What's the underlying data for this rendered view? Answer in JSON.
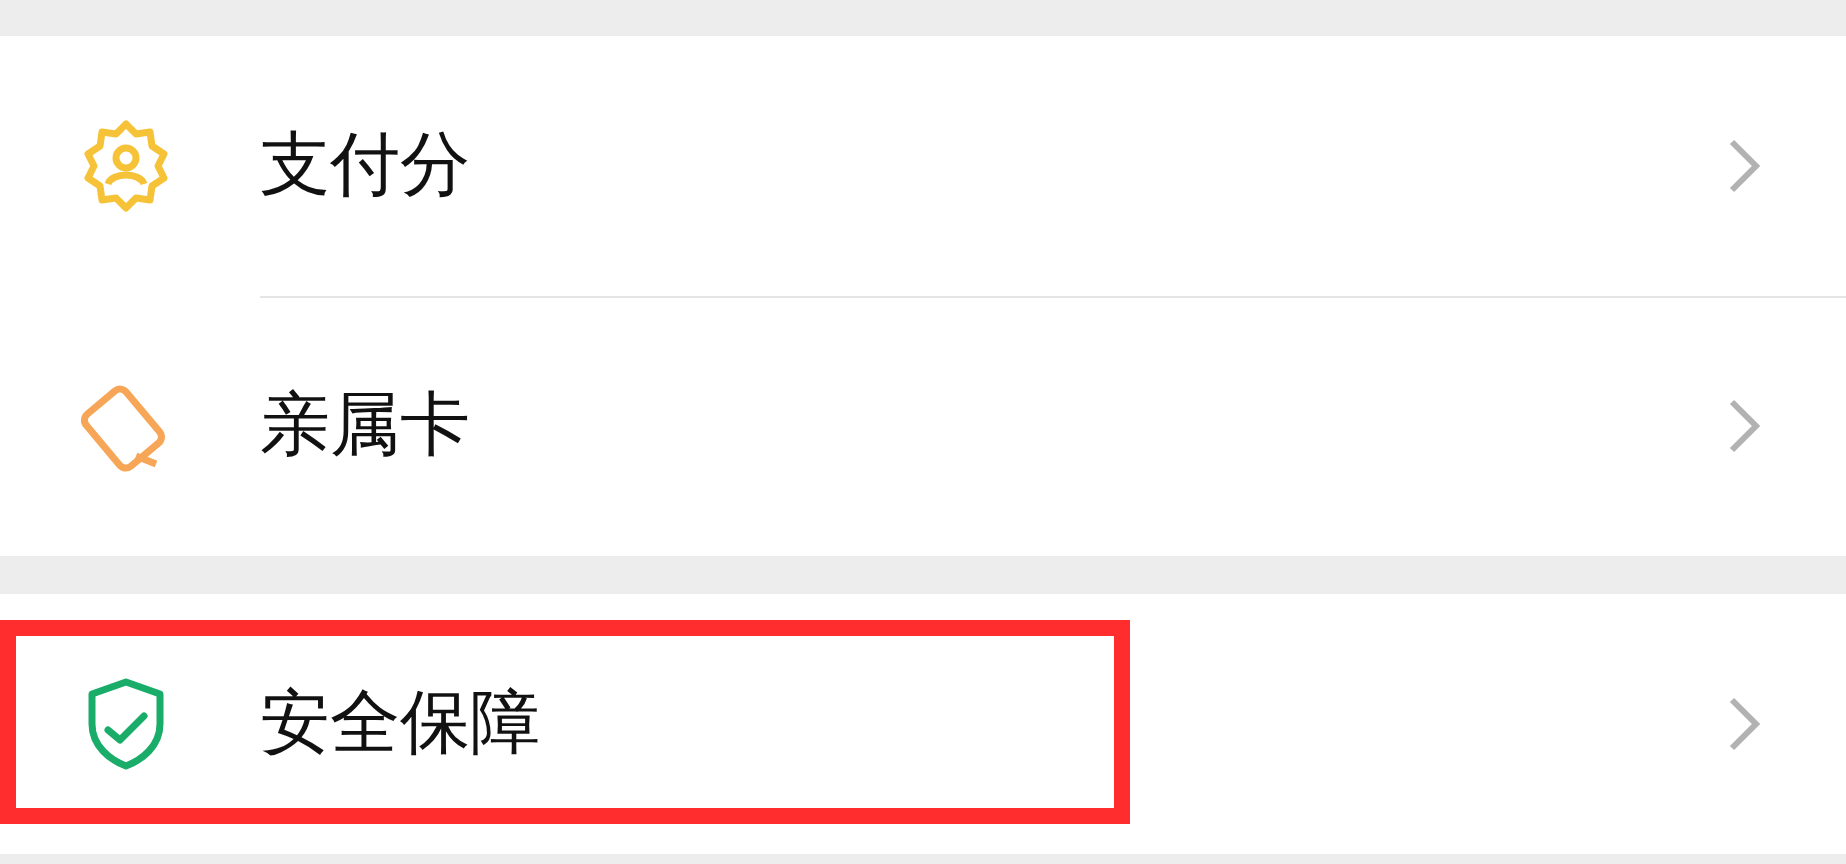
{
  "sections": [
    {
      "items": [
        {
          "kind": "score",
          "label": "支付分",
          "highlighted": false
        },
        {
          "kind": "family-card",
          "label": "亲属卡",
          "highlighted": false
        }
      ]
    },
    {
      "items": [
        {
          "kind": "security",
          "label": "安全保障",
          "highlighted": true
        }
      ]
    }
  ]
}
